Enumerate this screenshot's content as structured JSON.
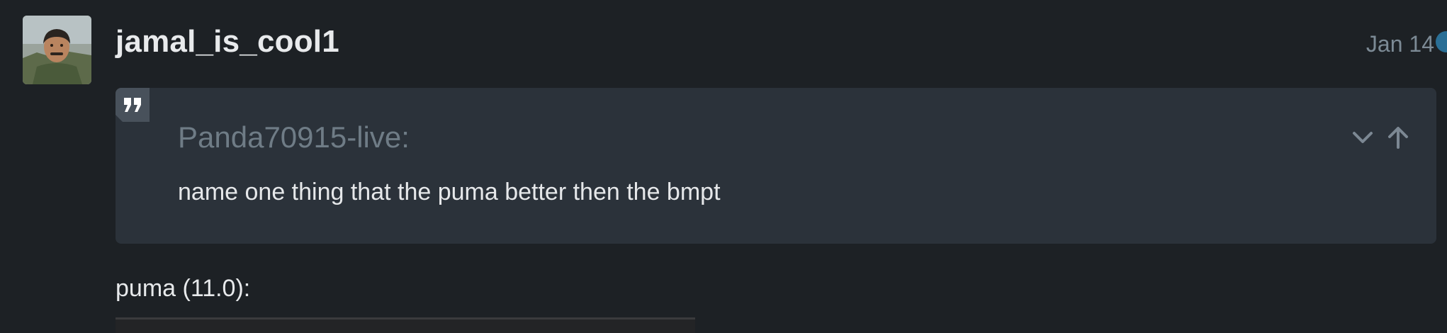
{
  "post": {
    "username": "jamal_is_cool1",
    "date": "Jan 14",
    "avatar_icon": "user-avatar-photo"
  },
  "quote": {
    "author": "Panda70915-live:",
    "text": "name one thing that the puma better then the bmpt",
    "icons": {
      "badge": "quote-marks-icon",
      "expand": "chevron-down-icon",
      "jump": "arrow-up-icon"
    }
  },
  "reply": {
    "text": "puma (11.0):"
  },
  "colors": {
    "background": "#1d2125",
    "quote_background": "#2b323a",
    "muted_text": "#6f7c86",
    "accent_dot": "#2a6f96"
  }
}
